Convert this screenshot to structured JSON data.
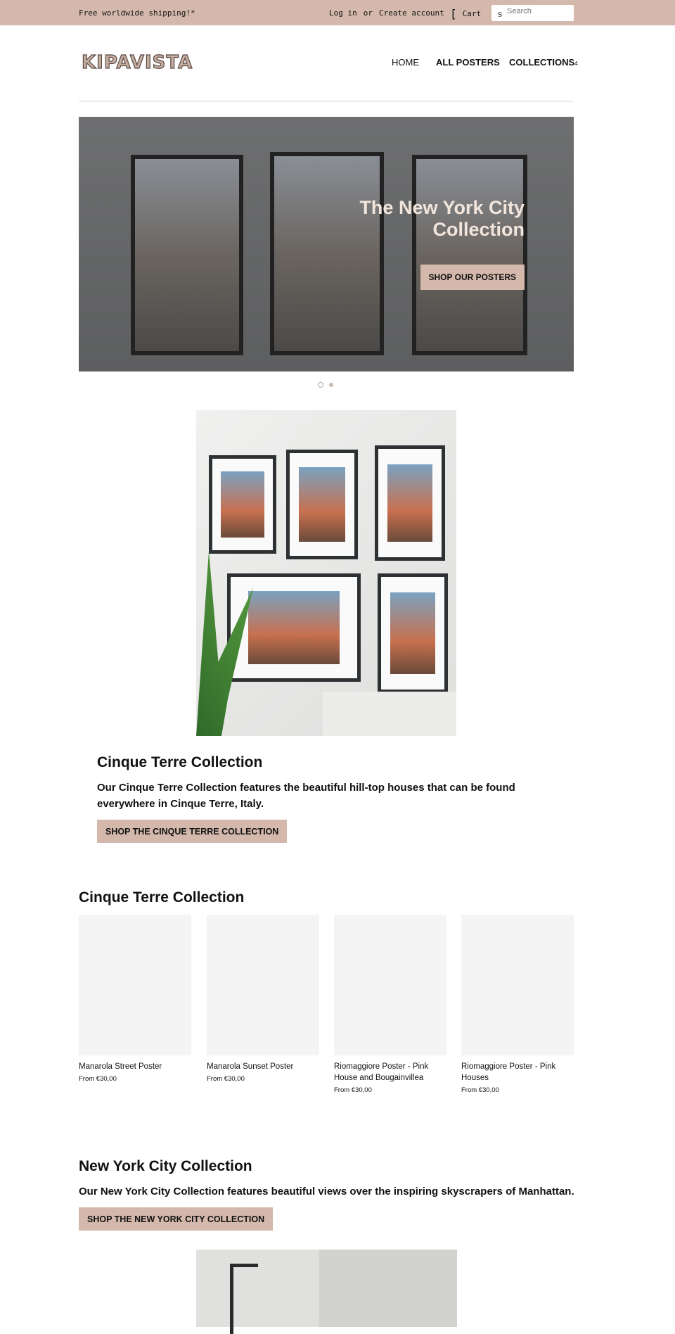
{
  "topbar": {
    "shipping": "Free worldwide shipping!*",
    "login": "Log in",
    "or": "or",
    "create": "Create account",
    "cart_icon": "[",
    "cart": "Cart",
    "search_icon": "S",
    "search_placeholder": "Search"
  },
  "header": {
    "logo": "KIPAVISTA",
    "nav": [
      "HOME",
      "ALL POSTERS",
      "COLLECTIONS"
    ],
    "collections_caret": "4"
  },
  "hero": {
    "title_line1": "The New York City",
    "title_line2": "Collection",
    "button": "SHOP OUR POSTERS",
    "slides": 2,
    "active_slide": 1
  },
  "featured": {
    "title": "Cinque Terre Collection",
    "text": "Our Cinque Terre Collection features the beautiful hill-top houses that can be found everywhere in Cinque Terre, Italy.",
    "button": "SHOP THE CINQUE TERRE COLLECTION"
  },
  "products_section": {
    "title": "Cinque Terre Collection",
    "products": [
      {
        "name": "Manarola Street Poster",
        "price": "From €30,00"
      },
      {
        "name": "Manarola Sunset Poster",
        "price": "From €30,00"
      },
      {
        "name": "Riomaggiore Poster - Pink House and Bougainvillea",
        "price": "From €30,00"
      },
      {
        "name": "Riomaggiore Poster - Pink Houses",
        "price": "From €30,00"
      }
    ]
  },
  "nyc": {
    "title": "New York City Collection",
    "text": "Our New York City Collection features beautiful views over the inspiring skyscrapers of Manhattan.",
    "button": "SHOP THE NEW YORK CITY COLLECTION"
  },
  "colors": {
    "accent": "#d3b8ab"
  }
}
